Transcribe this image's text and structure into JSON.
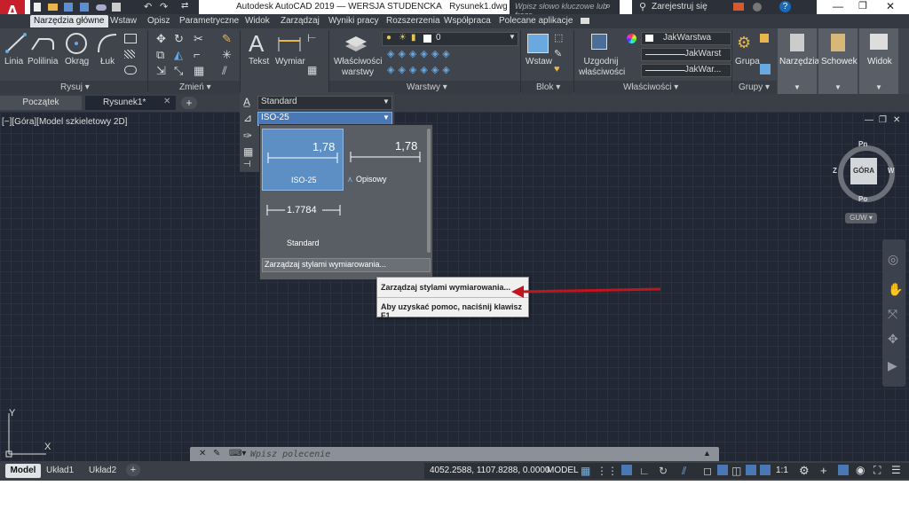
{
  "app": {
    "title": "Autodesk AutoCAD 2019 — WERSJA STUDENCKA",
    "document": "Rysunek1.dwg",
    "search_placeholder": "Wpisz słowo kluczowe lub frazę",
    "signin": "Zarejestruj się",
    "logo_letter": "A"
  },
  "ribbon_tabs": [
    "Narzędzia główne",
    "Wstaw",
    "Opisz",
    "Parametryczne",
    "Widok",
    "Zarządzaj",
    "Wyniki pracy",
    "Rozszerzenia",
    "Współpraca",
    "Polecane aplikacje"
  ],
  "ribbon": {
    "draw_tools": [
      "Linia",
      "Polilinia",
      "Okrąg",
      "Łuk"
    ],
    "panel_rysuj": "Rysuj",
    "panel_zmien": "Zmień",
    "text_btn": "Tekst",
    "dim_btn": "Wymiar",
    "props_btn": "Właściwości warstwy",
    "layer_value": "0",
    "panel_warstwy": "Warstwy",
    "insert_btn": "Wstaw",
    "panel_blok": "Blok",
    "match_btn": "Uzgodnij właściwości",
    "color_value": "JakWarstwa",
    "linetype_value": "JakWarst",
    "lineweight_value": "JakWar...",
    "panel_wlasciwosci": "Właściwości",
    "group_btn": "Grupa",
    "panel_grupy": "Grupy",
    "narzedzia": "Narzędzia",
    "schowek": "Schowek",
    "widok": "Widok"
  },
  "doctabs": [
    "Początek",
    "Rysunek1*"
  ],
  "viewport_label": "[−][Góra][Model szkieletowy 2D]",
  "annotation": {
    "text_style": "Standard",
    "dim_style": "ISO-25"
  },
  "gallery": [
    {
      "name": "ISO-25",
      "value": "1,78"
    },
    {
      "name": "Opisowy",
      "value": "1,78"
    },
    {
      "name": "Standard",
      "value": "1.7784"
    }
  ],
  "gallery_footer": "Zarządzaj stylami wymiarowania...",
  "tooltip": {
    "title": "Zarządzaj stylami wymiarowania...",
    "help": "Aby uzyskać pomoc, naciśnij klawisz F1"
  },
  "viewcube": {
    "n": "Pn",
    "s": "Po",
    "e": "W",
    "w": "Z",
    "face": "GÓRA",
    "ucs": "GUW"
  },
  "command_placeholder": "Wpisz polecenie",
  "layout_tabs": [
    "Model",
    "Układ1",
    "Układ2"
  ],
  "status": {
    "coords": "4052.2588, 1107.8288, 0.0000",
    "model": "MODEL",
    "scale": "1:1"
  },
  "ucs_axes": {
    "x": "X",
    "y": "Y"
  },
  "colors": {
    "accent": "#7eb2e3",
    "arrow": "#c0151c"
  }
}
